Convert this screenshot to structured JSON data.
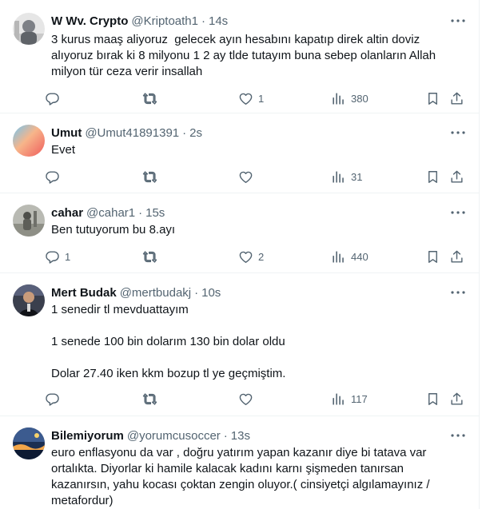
{
  "tweets": [
    {
      "name": "W Wv. Crypto",
      "handle": "@Kriptoath1",
      "time": "14s",
      "text": "3 kurus maaş aliyoruz  gelecek ayın hesabını kapatıp direk altin doviz\nalıyoruz bırak ki 8 milyonu 1 2 ay tlde tutayım buna sebep olanların Allah\nmilyon tür ceza verir insallah",
      "replies": "",
      "retweets": "",
      "likes": "1",
      "views": "380",
      "avatar_color": "#9aa0a6"
    },
    {
      "name": "Umut",
      "handle": "@Umut41891391",
      "time": "2s",
      "text": "Evet",
      "replies": "",
      "retweets": "",
      "likes": "",
      "views": "31",
      "avatar_color": "#f08a6a"
    },
    {
      "name": "cahar",
      "handle": "@cahar1",
      "time": "15s",
      "text": "Ben tutuyorum bu 8.ayı",
      "replies": "1",
      "retweets": "",
      "likes": "2",
      "views": "440",
      "avatar_color": "#8b8f86"
    },
    {
      "name": "Mert Budak",
      "handle": "@mertbudakj",
      "time": "10s",
      "text": "1 senedir tl mevduattayım\n\n1 senede 100 bin dolarım 130 bin dolar oldu\n\nDolar 27.40 iken kkm bozup tl ye geçmiştim.",
      "replies": "",
      "retweets": "",
      "likes": "",
      "views": "117",
      "avatar_color": "#2b2f3a"
    },
    {
      "name": "Bilemiyorum",
      "handle": "@yorumcusoccer",
      "time": "13s",
      "text": "euro enflasyonu da var , doğru yatırım yapan kazanır diye bi tatava var\nortalıkta. Diyorlar ki hamile kalacak kadını karnı şişmeden tanırsan\nkazanırsın, yahu kocası çoktan zengin oluyor.( cinsiyetçi algılamayınız /\nmetafordur)",
      "replies": "",
      "retweets": "",
      "likes": "",
      "views": "",
      "avatar_color": "#1d3a5f"
    }
  ],
  "colors": {
    "text": "#0f1419",
    "secondary": "#536471",
    "border": "#eff3f4"
  },
  "icons": [
    "reply-icon",
    "retweet-icon",
    "like-icon",
    "views-icon",
    "bookmark-icon",
    "share-icon",
    "more-icon"
  ]
}
